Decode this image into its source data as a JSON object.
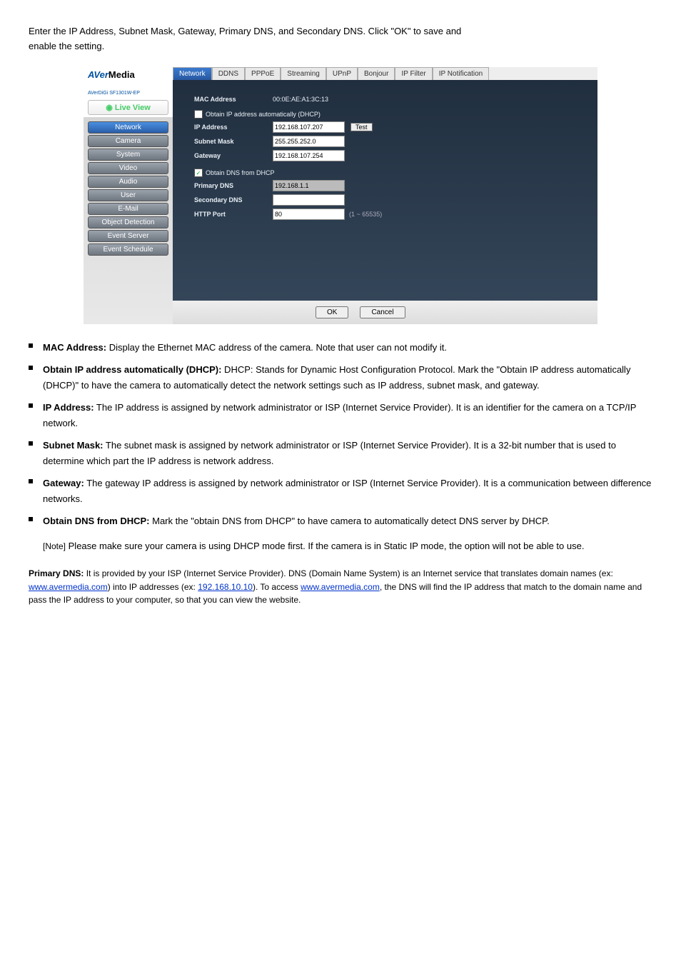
{
  "intro": {
    "line1_full": "Enter the IP Address, Subnet Mask, Gateway, Primary DNS, and Secondary DNS. Click \"OK\" to save and",
    "line2": "enable the setting."
  },
  "screenshot": {
    "brand_aver": "AVer",
    "brand_media": "Media",
    "subbrand": "AVerDiGi SF1301W-EP",
    "live_view": "Live View",
    "side_nav": [
      "Network",
      "Camera",
      "System",
      "Video",
      "Audio",
      "User",
      "E-Mail",
      "Object Detection",
      "Event Server",
      "Event Schedule"
    ],
    "tabs": [
      "Network",
      "DDNS",
      "PPPoE",
      "Streaming",
      "UPnP",
      "Bonjour",
      "IP Filter",
      "IP Notification"
    ],
    "labels": {
      "mac": "MAC Address",
      "mac_val": "00:0E:AE:A1:3C:13",
      "dhcp": "Obtain IP address automatically (DHCP)",
      "ip": "IP Address",
      "ip_val": "192.168.107.207",
      "test": "Test",
      "subnet": "Subnet Mask",
      "subnet_val": "255.255.252.0",
      "gw": "Gateway",
      "gw_val": "192.168.107.254",
      "dns_dhcp": "Obtain DNS from DHCP",
      "pdns": "Primary DNS",
      "pdns_val": "192.168.1.1",
      "sdns": "Secondary DNS",
      "sdns_val": "",
      "http": "HTTP Port",
      "http_val": "80",
      "http_note": "(1 ~ 65535)"
    },
    "ok": "OK",
    "cancel": "Cancel"
  },
  "params": [
    {
      "b": "MAC Address:",
      "t": " Display the Ethernet MAC address of the camera. Note that user can not modify it."
    },
    {
      "b": "Obtain IP address automatically (DHCP):",
      "t": " DHCP: Stands for Dynamic Host Configuration Protocol. Mark the \"Obtain IP address automatically (DHCP)\" to have the camera to automatically detect the network settings such as IP address, subnet mask, and gateway."
    },
    {
      "b": "IP Address:",
      "t": " The IP address is assigned by network administrator or ISP (Internet Service Provider). It is an identifier for the camera on a TCP/IP network."
    },
    {
      "b": "Subnet Mask:",
      "t": " The subnet mask is assigned by network administrator or ISP (Internet Service Provider). It is a 32-bit number that is used to determine which part the IP address is network address."
    },
    {
      "b": "Gateway:",
      "t": " The gateway IP address is assigned by network administrator or ISP (Internet Service Provider). It is a communication between difference networks."
    },
    {
      "b": "Obtain DNS from DHCP:",
      "t": " Mark the \"obtain DNS from DHCP\" to have camera to automatically detect DNS server by DHCP."
    }
  ],
  "note": {
    "head": "[Note]",
    "body": "Please make sure your camera is using DHCP mode first. If the camera is in Static IP mode, the option will not be able to use."
  },
  "foot": {
    "pdns_b": "Primary DNS:",
    "pdns_t": " It is provided by your ISP (Internet Service Provider). DNS (Domain Name System) is an Internet service that translates domain names (ex:",
    "link1": "www.avermedia.com",
    "mid": ") into IP addresses (ex:",
    "link2": "192.168.10.10",
    "mid2": "). To access",
    "link3": "www.avermedia.com",
    "tail": ", the DNS will find the IP address that match to the domain name and pass the IP address to your computer, so that you can view the website."
  }
}
